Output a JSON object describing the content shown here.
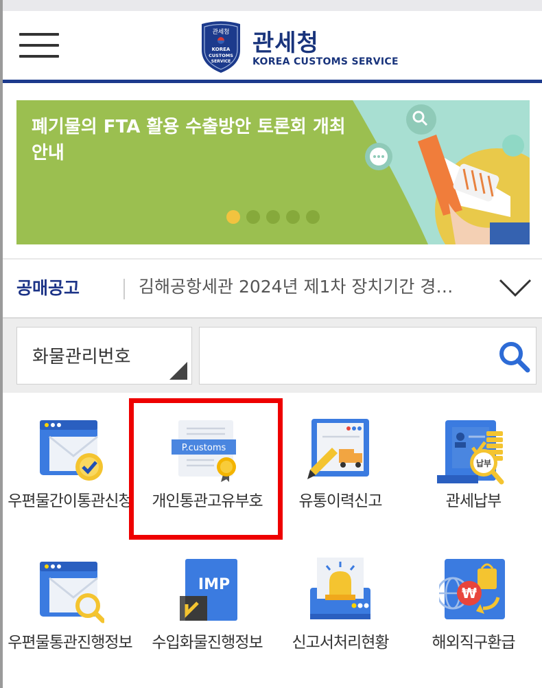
{
  "header": {
    "logo_title": "관세청",
    "logo_subtitle": "KOREA CUSTOMS SERVICE",
    "emblem_lines": [
      "관세청",
      "KOREA",
      "CUSTOMS",
      "SERVICE"
    ],
    "brand_color": "#1c3a8c"
  },
  "banner": {
    "text": "폐기물의 FTA 활용 수출방안 토론회 개최 안내",
    "slide_count": 5,
    "active_slide": 1,
    "background_color": "#9bbf50"
  },
  "notice": {
    "category": "공매공고",
    "text": "김해공항세관 2024년 제1차 장치기간 경…"
  },
  "search": {
    "select_value": "화물관리번호",
    "input_value": "",
    "input_placeholder": ""
  },
  "menu": {
    "items": [
      {
        "label": "우편물간이통관신청",
        "icon": "mail-check-icon"
      },
      {
        "label": "개인통관고유부호",
        "icon": "p-customs-certificate-icon",
        "icon_text": "P.customs",
        "highlighted": true
      },
      {
        "label": "유통이력신고",
        "icon": "truck-report-icon"
      },
      {
        "label": "관세납부",
        "icon": "tax-payment-icon",
        "icon_text": "납부"
      },
      {
        "label": "우편물통관진행정보",
        "icon": "mail-search-icon"
      },
      {
        "label": "수입화물진행정보",
        "icon": "import-cargo-icon",
        "icon_text": "IMP"
      },
      {
        "label": "신고서처리현황",
        "icon": "alarm-light-icon"
      },
      {
        "label": "해외직구환급",
        "icon": "overseas-refund-icon",
        "icon_text": "₩"
      }
    ]
  },
  "highlight_color": "#ee0000"
}
